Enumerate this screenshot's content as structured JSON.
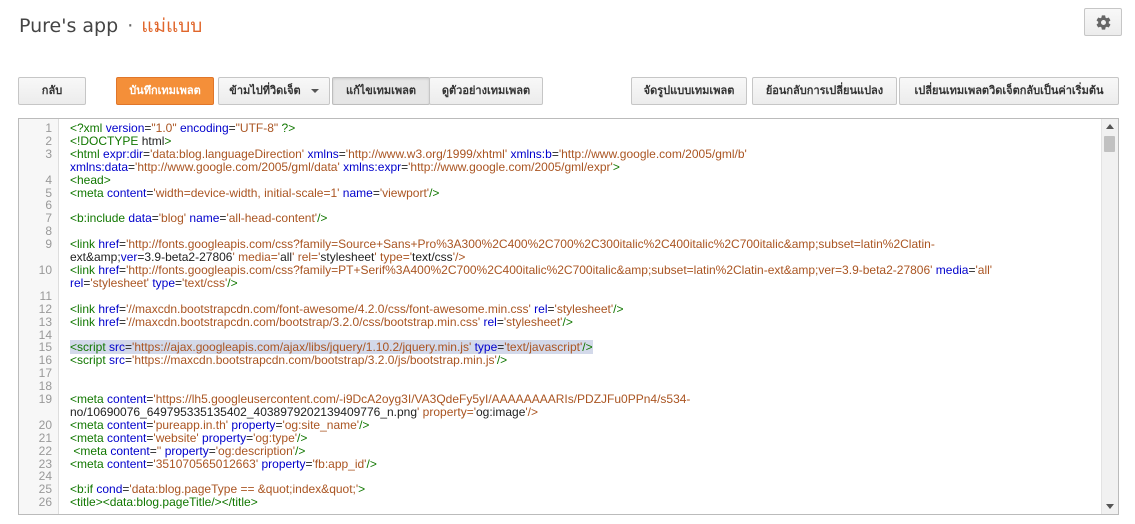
{
  "header": {
    "app_name": "Pure's app",
    "separator": "·",
    "section": "แม่แบบ"
  },
  "toolbar": {
    "back": "กลับ",
    "save": "บันทึกเทมเพลต",
    "jump_widget": "ข้ามไปที่วิดเจ็ต",
    "edit_template": "แก้ไขเทมเพลต",
    "preview_template": "ดูตัวอย่างเทมเพลต",
    "format_template": "จัดรูปแบบเทมเพลต",
    "revert_changes": "ย้อนกลับการเปลี่ยนแปลง",
    "revert_widgets": "เปลี่ยนเทมเพลตวิดเจ็ตกลับเป็นค่าเริ่มต้น"
  },
  "editor": {
    "lines": [
      {
        "num": "1",
        "text": "<?xml version=\"1.0\" encoding=\"UTF-8\" ?>"
      },
      {
        "num": "2",
        "text": "<!DOCTYPE html>"
      },
      {
        "num": "3",
        "text": "<html expr:dir='data:blog.languageDirection' xmlns='http://www.w3.org/1999/xhtml' xmlns:b='http://www.google.com/2005/gml/b'"
      },
      {
        "num": "",
        "text": "xmlns:data='http://www.google.com/2005/gml/data' xmlns:expr='http://www.google.com/2005/gml/expr'>"
      },
      {
        "num": "4",
        "text": "<head>"
      },
      {
        "num": "5",
        "text": "<meta content='width=device-width, initial-scale=1' name='viewport'/>"
      },
      {
        "num": "6",
        "text": ""
      },
      {
        "num": "7",
        "text": "<b:include data='blog' name='all-head-content'/>"
      },
      {
        "num": "8",
        "text": ""
      },
      {
        "num": "9",
        "text": "<link href='http://fonts.googleapis.com/css?family=Source+Sans+Pro%3A300%2C400%2C700%2C300italic%2C400italic%2C700italic&amp;subset=latin%2Clatin-"
      },
      {
        "num": "",
        "text": "ext&amp;ver=3.9-beta2-27806' media='all' rel='stylesheet' type='text/css'/>"
      },
      {
        "num": "10",
        "text": "<link href='http://fonts.googleapis.com/css?family=PT+Serif%3A400%2C700%2C400italic%2C700italic&amp;subset=latin%2Clatin-ext&amp;ver=3.9-beta2-27806' media='all'"
      },
      {
        "num": "",
        "text": "rel='stylesheet' type='text/css'/>"
      },
      {
        "num": "11",
        "text": ""
      },
      {
        "num": "12",
        "text": "<link href='//maxcdn.bootstrapcdn.com/font-awesome/4.2.0/css/font-awesome.min.css' rel='stylesheet'/>"
      },
      {
        "num": "13",
        "text": "<link href='//maxcdn.bootstrapcdn.com/bootstrap/3.2.0/css/bootstrap.min.css' rel='stylesheet'/>"
      },
      {
        "num": "14",
        "text": ""
      },
      {
        "num": "15",
        "text": "<script src='https://ajax.googleapis.com/ajax/libs/jquery/1.10.2/jquery.min.js' type='text/javascript'/>",
        "highlight": true
      },
      {
        "num": "16",
        "text": "<script src='https://maxcdn.bootstrapcdn.com/bootstrap/3.2.0/js/bootstrap.min.js'/>"
      },
      {
        "num": "17",
        "text": ""
      },
      {
        "num": "18",
        "text": ""
      },
      {
        "num": "19",
        "text": "<meta content='https://lh5.googleusercontent.com/-i9DcA2oyg3I/VA3QdeFy5yI/AAAAAAAARIs/PDZJFu0PPn4/s534-"
      },
      {
        "num": "",
        "text": "no/10690076_649795335135402_4038979202139409776_n.png' property='og:image'/>"
      },
      {
        "num": "20",
        "text": "<meta content='pureapp.in.th' property='og:site_name'/>"
      },
      {
        "num": "21",
        "text": "<meta content='website' property='og:type'/>"
      },
      {
        "num": "22",
        "text": " <meta content='' property='og:description'/>"
      },
      {
        "num": "23",
        "text": "<meta content='351070565012663' property='fb:app_id'/>"
      },
      {
        "num": "24",
        "text": ""
      },
      {
        "num": "25",
        "text": "<b:if cond='data:blog.pageType == &quot;index&quot;'>"
      },
      {
        "num": "26",
        "text": "<title><data:blog.pageTitle/></title>"
      }
    ]
  },
  "icons": {
    "settings": "gear-icon",
    "dropdown": "chevron-down-icon"
  },
  "colors": {
    "primary_button": "#f48f39",
    "accent_text": "#e0662b",
    "tag": "#117700",
    "attribute": "#0000cc",
    "string": "#aa5522",
    "highlight": "#d3d9ea"
  }
}
